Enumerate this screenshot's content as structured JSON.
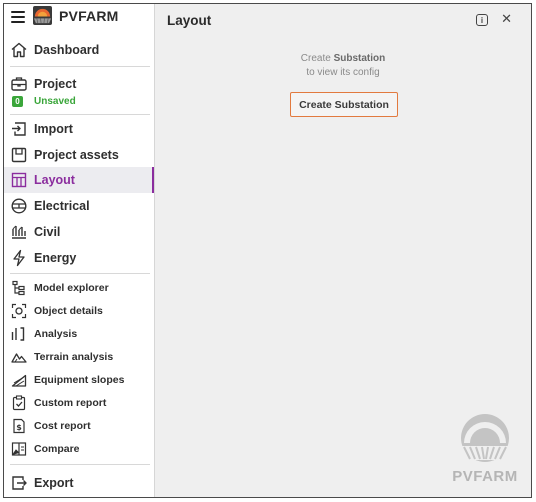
{
  "app": {
    "brand_name": "PVFARM",
    "project_status_badge": "0",
    "project_status_text": "Unsaved"
  },
  "sidebar": {
    "primary": [
      {
        "label": "Dashboard",
        "icon": "home-icon"
      },
      {
        "label": "Project",
        "icon": "briefcase-icon"
      },
      {
        "label": "Import",
        "icon": "import-icon"
      },
      {
        "label": "Project assets",
        "icon": "box-icon"
      },
      {
        "label": "Layout",
        "icon": "layout-icon",
        "active": true
      },
      {
        "label": "Electrical",
        "icon": "electrical-icon"
      },
      {
        "label": "Civil",
        "icon": "civil-icon"
      },
      {
        "label": "Energy",
        "icon": "lightning-icon"
      }
    ],
    "secondary": [
      {
        "label": "Model explorer",
        "icon": "tree-icon"
      },
      {
        "label": "Object details",
        "icon": "object-focus-icon"
      },
      {
        "label": "Analysis",
        "icon": "analysis-icon"
      },
      {
        "label": "Terrain analysis",
        "icon": "terrain-icon"
      },
      {
        "label": "Equipment slopes",
        "icon": "slope-icon"
      },
      {
        "label": "Custom report",
        "icon": "clipboard-check-icon"
      },
      {
        "label": "Cost report",
        "icon": "dollar-doc-icon"
      },
      {
        "label": "Compare",
        "icon": "compare-icon"
      }
    ],
    "footer": [
      {
        "label": "Export",
        "icon": "export-icon"
      }
    ]
  },
  "main": {
    "title": "Layout",
    "empty_line1_prefix": "Create ",
    "empty_line1_bold": "Substation",
    "empty_line2": "to view its config",
    "create_button_label": "Create Substation",
    "watermark_text": "PVFARM"
  },
  "colors": {
    "accent": "#8b2d9e",
    "unsaved_green": "#3aa63a",
    "button_border": "#e27a3f"
  }
}
